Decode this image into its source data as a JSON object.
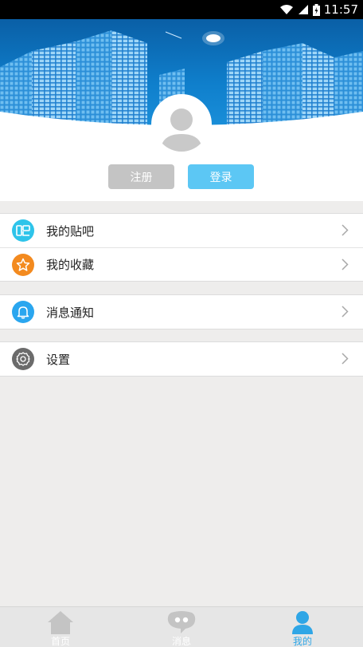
{
  "status_bar": {
    "time": "11:57"
  },
  "auth": {
    "register_label": "注册",
    "login_label": "登录"
  },
  "menu": {
    "group1": [
      {
        "label": "我的贴吧",
        "icon": "tieba-icon",
        "color": "#2ec4ea"
      },
      {
        "label": "我的收藏",
        "icon": "star-icon",
        "color": "#f38a1f"
      }
    ],
    "group2": [
      {
        "label": "消息通知",
        "icon": "bell-icon",
        "color": "#2aa6ef"
      }
    ],
    "group3": [
      {
        "label": "设置",
        "icon": "gear-icon",
        "color": "#6b6b6b"
      }
    ]
  },
  "tabbar": {
    "tabs": [
      {
        "label": "首页",
        "icon": "home-icon"
      },
      {
        "label": "消息",
        "icon": "chat-icon"
      },
      {
        "label": "我的",
        "icon": "person-icon",
        "active": true
      }
    ]
  }
}
